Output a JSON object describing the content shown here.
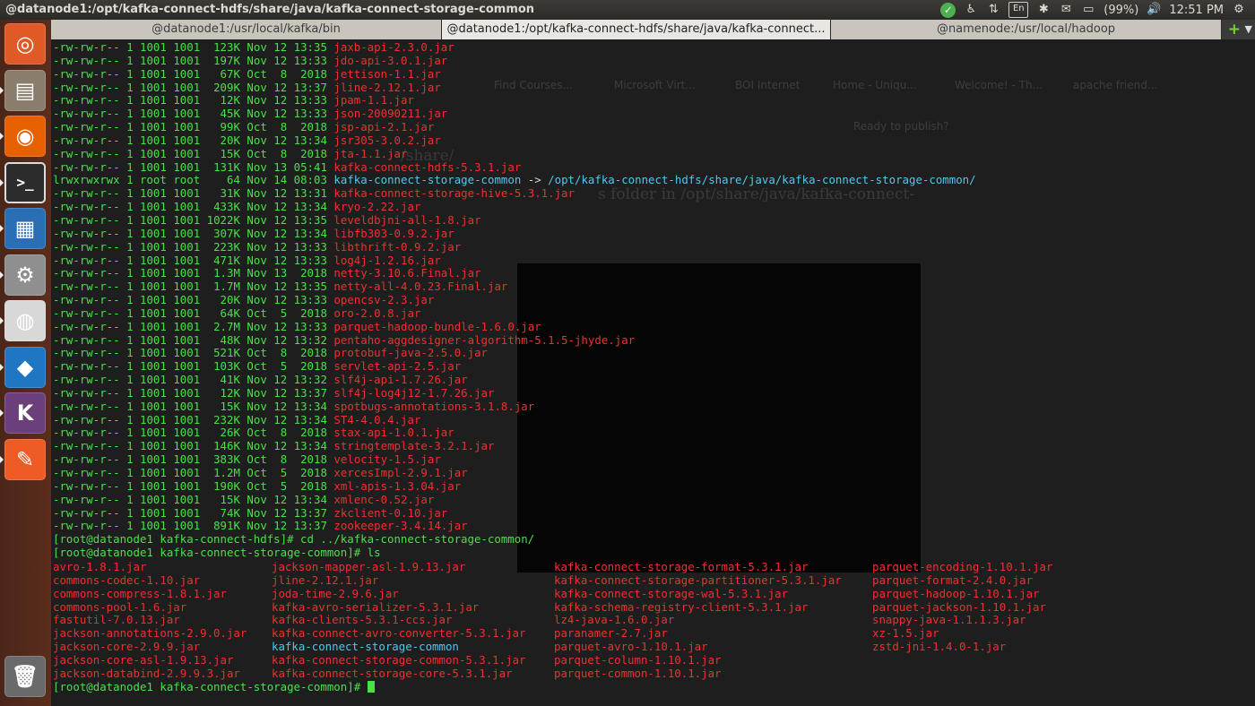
{
  "window": {
    "title": "@datanode1:/opt/kafka-connect-hdfs/share/java/kafka-connect-storage-common"
  },
  "tray": {
    "keyboard": "En",
    "battery": "(99%)",
    "time": "12:51 PM"
  },
  "tabs": [
    {
      "label": "@datanode1:/usr/local/kafka/bin",
      "active": false
    },
    {
      "label": "@datanode1:/opt/kafka-connect-hdfs/share/java/kafka-connect...",
      "active": true
    },
    {
      "label": "@namenode:/usr/local/hadoop",
      "active": false
    }
  ],
  "ghost_background": {
    "texts": [
      "/share/",
      "s folder in /opt/share/java/kafka-connect-"
    ],
    "ui": [
      "Find Courses...",
      "Microsoft Virt...",
      "BOI Internet",
      "Home - Uniqu...",
      "Welcome! - Th...",
      "apache friend...",
      "Ready to publish?"
    ]
  },
  "listing": [
    {
      "perm": "-rw-rw-r--",
      "links": "1",
      "owner": "1001",
      "group": "1001",
      "size": " 123K",
      "date": "Nov 12 13:35",
      "name": "jaxb-api-2.3.0.jar"
    },
    {
      "perm": "-rw-rw-r--",
      "links": "1",
      "owner": "1001",
      "group": "1001",
      "size": " 197K",
      "date": "Nov 12 13:33",
      "name": "jdo-api-3.0.1.jar"
    },
    {
      "perm": "-rw-rw-r--",
      "links": "1",
      "owner": "1001",
      "group": "1001",
      "size": "  67K",
      "date": "Oct  8  2018",
      "name": "jettison-1.1.jar"
    },
    {
      "perm": "-rw-rw-r--",
      "links": "1",
      "owner": "1001",
      "group": "1001",
      "size": " 209K",
      "date": "Nov 12 13:37",
      "name": "jline-2.12.1.jar"
    },
    {
      "perm": "-rw-rw-r--",
      "links": "1",
      "owner": "1001",
      "group": "1001",
      "size": "  12K",
      "date": "Nov 12 13:33",
      "name": "jpam-1.1.jar"
    },
    {
      "perm": "-rw-rw-r--",
      "links": "1",
      "owner": "1001",
      "group": "1001",
      "size": "  45K",
      "date": "Nov 12 13:33",
      "name": "json-20090211.jar"
    },
    {
      "perm": "-rw-rw-r--",
      "links": "1",
      "owner": "1001",
      "group": "1001",
      "size": "  99K",
      "date": "Oct  8  2018",
      "name": "jsp-api-2.1.jar"
    },
    {
      "perm": "-rw-rw-r--",
      "links": "1",
      "owner": "1001",
      "group": "1001",
      "size": "  20K",
      "date": "Nov 12 13:34",
      "name": "jsr305-3.0.2.jar"
    },
    {
      "perm": "-rw-rw-r--",
      "links": "1",
      "owner": "1001",
      "group": "1001",
      "size": "  15K",
      "date": "Oct  8  2018",
      "name": "jta-1.1.jar"
    },
    {
      "perm": "-rw-rw-r--",
      "links": "1",
      "owner": "1001",
      "group": "1001",
      "size": " 131K",
      "date": "Nov 13 05:41",
      "name": "kafka-connect-hdfs-5.3.1.jar"
    },
    {
      "perm": "lrwxrwxrwx",
      "links": "1",
      "owner": "root",
      "group": "root",
      "size": "   64",
      "date": "Nov 14 08:03",
      "name": "kafka-connect-storage-common",
      "link": "/opt/kafka-connect-hdfs/share/java/kafka-connect-storage-common/"
    },
    {
      "perm": "-rw-rw-r--",
      "links": "1",
      "owner": "1001",
      "group": "1001",
      "size": "  31K",
      "date": "Nov 12 13:31",
      "name": "kafka-connect-storage-hive-5.3.1.jar"
    },
    {
      "perm": "-rw-rw-r--",
      "links": "1",
      "owner": "1001",
      "group": "1001",
      "size": " 433K",
      "date": "Nov 12 13:34",
      "name": "kryo-2.22.jar"
    },
    {
      "perm": "-rw-rw-r--",
      "links": "1",
      "owner": "1001",
      "group": "1001",
      "size": "1022K",
      "date": "Nov 12 13:35",
      "name": "leveldbjni-all-1.8.jar"
    },
    {
      "perm": "-rw-rw-r--",
      "links": "1",
      "owner": "1001",
      "group": "1001",
      "size": " 307K",
      "date": "Nov 12 13:34",
      "name": "libfb303-0.9.2.jar"
    },
    {
      "perm": "-rw-rw-r--",
      "links": "1",
      "owner": "1001",
      "group": "1001",
      "size": " 223K",
      "date": "Nov 12 13:33",
      "name": "libthrift-0.9.2.jar"
    },
    {
      "perm": "-rw-rw-r--",
      "links": "1",
      "owner": "1001",
      "group": "1001",
      "size": " 471K",
      "date": "Nov 12 13:33",
      "name": "log4j-1.2.16.jar"
    },
    {
      "perm": "-rw-rw-r--",
      "links": "1",
      "owner": "1001",
      "group": "1001",
      "size": " 1.3M",
      "date": "Nov 13  2018",
      "name": "netty-3.10.6.Final.jar"
    },
    {
      "perm": "-rw-rw-r--",
      "links": "1",
      "owner": "1001",
      "group": "1001",
      "size": " 1.7M",
      "date": "Nov 12 13:35",
      "name": "netty-all-4.0.23.Final.jar"
    },
    {
      "perm": "-rw-rw-r--",
      "links": "1",
      "owner": "1001",
      "group": "1001",
      "size": "  20K",
      "date": "Nov 12 13:33",
      "name": "opencsv-2.3.jar"
    },
    {
      "perm": "-rw-rw-r--",
      "links": "1",
      "owner": "1001",
      "group": "1001",
      "size": "  64K",
      "date": "Oct  5  2018",
      "name": "oro-2.0.8.jar"
    },
    {
      "perm": "-rw-rw-r--",
      "links": "1",
      "owner": "1001",
      "group": "1001",
      "size": " 2.7M",
      "date": "Nov 12 13:33",
      "name": "parquet-hadoop-bundle-1.6.0.jar"
    },
    {
      "perm": "-rw-rw-r--",
      "links": "1",
      "owner": "1001",
      "group": "1001",
      "size": "  48K",
      "date": "Nov 12 13:32",
      "name": "pentaho-aggdesigner-algorithm-5.1.5-jhyde.jar"
    },
    {
      "perm": "-rw-rw-r--",
      "links": "1",
      "owner": "1001",
      "group": "1001",
      "size": " 521K",
      "date": "Oct  8  2018",
      "name": "protobuf-java-2.5.0.jar"
    },
    {
      "perm": "-rw-rw-r--",
      "links": "1",
      "owner": "1001",
      "group": "1001",
      "size": " 103K",
      "date": "Oct  5  2018",
      "name": "servlet-api-2.5.jar"
    },
    {
      "perm": "-rw-rw-r--",
      "links": "1",
      "owner": "1001",
      "group": "1001",
      "size": "  41K",
      "date": "Nov 12 13:32",
      "name": "slf4j-api-1.7.26.jar"
    },
    {
      "perm": "-rw-rw-r--",
      "links": "1",
      "owner": "1001",
      "group": "1001",
      "size": "  12K",
      "date": "Nov 12 13:37",
      "name": "slf4j-log4j12-1.7.26.jar"
    },
    {
      "perm": "-rw-rw-r--",
      "links": "1",
      "owner": "1001",
      "group": "1001",
      "size": "  15K",
      "date": "Nov 12 13:34",
      "name": "spotbugs-annotations-3.1.8.jar"
    },
    {
      "perm": "-rw-rw-r--",
      "links": "1",
      "owner": "1001",
      "group": "1001",
      "size": " 232K",
      "date": "Nov 12 13:34",
      "name": "ST4-4.0.4.jar"
    },
    {
      "perm": "-rw-rw-r--",
      "links": "1",
      "owner": "1001",
      "group": "1001",
      "size": "  26K",
      "date": "Oct  8  2018",
      "name": "stax-api-1.0.1.jar"
    },
    {
      "perm": "-rw-rw-r--",
      "links": "1",
      "owner": "1001",
      "group": "1001",
      "size": " 146K",
      "date": "Nov 12 13:34",
      "name": "stringtemplate-3.2.1.jar"
    },
    {
      "perm": "-rw-rw-r--",
      "links": "1",
      "owner": "1001",
      "group": "1001",
      "size": " 383K",
      "date": "Oct  8  2018",
      "name": "velocity-1.5.jar"
    },
    {
      "perm": "-rw-rw-r--",
      "links": "1",
      "owner": "1001",
      "group": "1001",
      "size": " 1.2M",
      "date": "Oct  5  2018",
      "name": "xercesImpl-2.9.1.jar"
    },
    {
      "perm": "-rw-rw-r--",
      "links": "1",
      "owner": "1001",
      "group": "1001",
      "size": " 190K",
      "date": "Oct  5  2018",
      "name": "xml-apis-1.3.04.jar"
    },
    {
      "perm": "-rw-rw-r--",
      "links": "1",
      "owner": "1001",
      "group": "1001",
      "size": "  15K",
      "date": "Nov 12 13:34",
      "name": "xmlenc-0.52.jar"
    },
    {
      "perm": "-rw-rw-r--",
      "links": "1",
      "owner": "1001",
      "group": "1001",
      "size": "  74K",
      "date": "Nov 12 13:37",
      "name": "zkclient-0.10.jar"
    },
    {
      "perm": "-rw-rw-r--",
      "links": "1",
      "owner": "1001",
      "group": "1001",
      "size": " 891K",
      "date": "Nov 12 13:37",
      "name": "zookeeper-3.4.14.jar"
    }
  ],
  "commands": [
    {
      "prompt": "[root@datanode1 kafka-connect-hdfs]#",
      "cmd": " cd ../kafka-connect-storage-common/"
    },
    {
      "prompt": "[root@datanode1 kafka-connect-storage-common]#",
      "cmd": " ls"
    }
  ],
  "ls_output": [
    [
      "avro-1.8.1.jar",
      "commons-codec-1.10.jar",
      "commons-compress-1.8.1.jar",
      "commons-pool-1.6.jar",
      "fastutil-7.0.13.jar",
      "jackson-annotations-2.9.0.jar",
      "jackson-core-2.9.9.jar",
      "jackson-core-asl-1.9.13.jar",
      "jackson-databind-2.9.9.3.jar"
    ],
    [
      "jackson-mapper-asl-1.9.13.jar",
      "jline-2.12.1.jar",
      "joda-time-2.9.6.jar",
      "kafka-avro-serializer-5.3.1.jar",
      "kafka-clients-5.3.1-ccs.jar",
      "kafka-connect-avro-converter-5.3.1.jar",
      "kafka-connect-storage-common",
      "kafka-connect-storage-common-5.3.1.jar",
      "kafka-connect-storage-core-5.3.1.jar"
    ],
    [
      "kafka-connect-storage-format-5.3.1.jar",
      "kafka-connect-storage-partitioner-5.3.1.jar",
      "kafka-connect-storage-wal-5.3.1.jar",
      "kafka-schema-registry-client-5.3.1.jar",
      "lz4-java-1.6.0.jar",
      "paranamer-2.7.jar",
      "parquet-avro-1.10.1.jar",
      "parquet-column-1.10.1.jar",
      "parquet-common-1.10.1.jar"
    ],
    [
      "parquet-encoding-1.10.1.jar",
      "parquet-format-2.4.0.jar",
      "parquet-hadoop-1.10.1.jar",
      "parquet-jackson-1.10.1.jar",
      "snappy-java-1.1.1.3.jar",
      "xz-1.5.jar",
      "zstd-jni-1.4.0-1.jar"
    ]
  ],
  "ls_highlight": "kafka-connect-storage-common",
  "final_prompt": "[root@datanode1 kafka-connect-storage-common]#",
  "launcher": [
    {
      "name": "ubuntu-icon",
      "color": "#e05a28",
      "glyph": "◎"
    },
    {
      "name": "files-icon",
      "color": "#8a7d6b",
      "glyph": "▤"
    },
    {
      "name": "firefox-icon",
      "color": "#e66000",
      "glyph": "◉"
    },
    {
      "name": "terminal-icon",
      "color": "#2c2c2c",
      "glyph": ">_"
    },
    {
      "name": "writer-icon",
      "color": "#2a6fb5",
      "glyph": "▦"
    },
    {
      "name": "settings-icon",
      "color": "#8f8f8f",
      "glyph": "⚙"
    },
    {
      "name": "chrome-icon",
      "color": "#d8d8d8",
      "glyph": "◍"
    },
    {
      "name": "vscode-icon",
      "color": "#1f77c4",
      "glyph": "◆"
    },
    {
      "name": "k-app-icon",
      "color": "#6b3f7a",
      "glyph": "K"
    },
    {
      "name": "postman-icon",
      "color": "#ef5b25",
      "glyph": "✎"
    },
    {
      "name": "trash-icon",
      "color": "#6a6a6a",
      "glyph": "🗑"
    }
  ]
}
